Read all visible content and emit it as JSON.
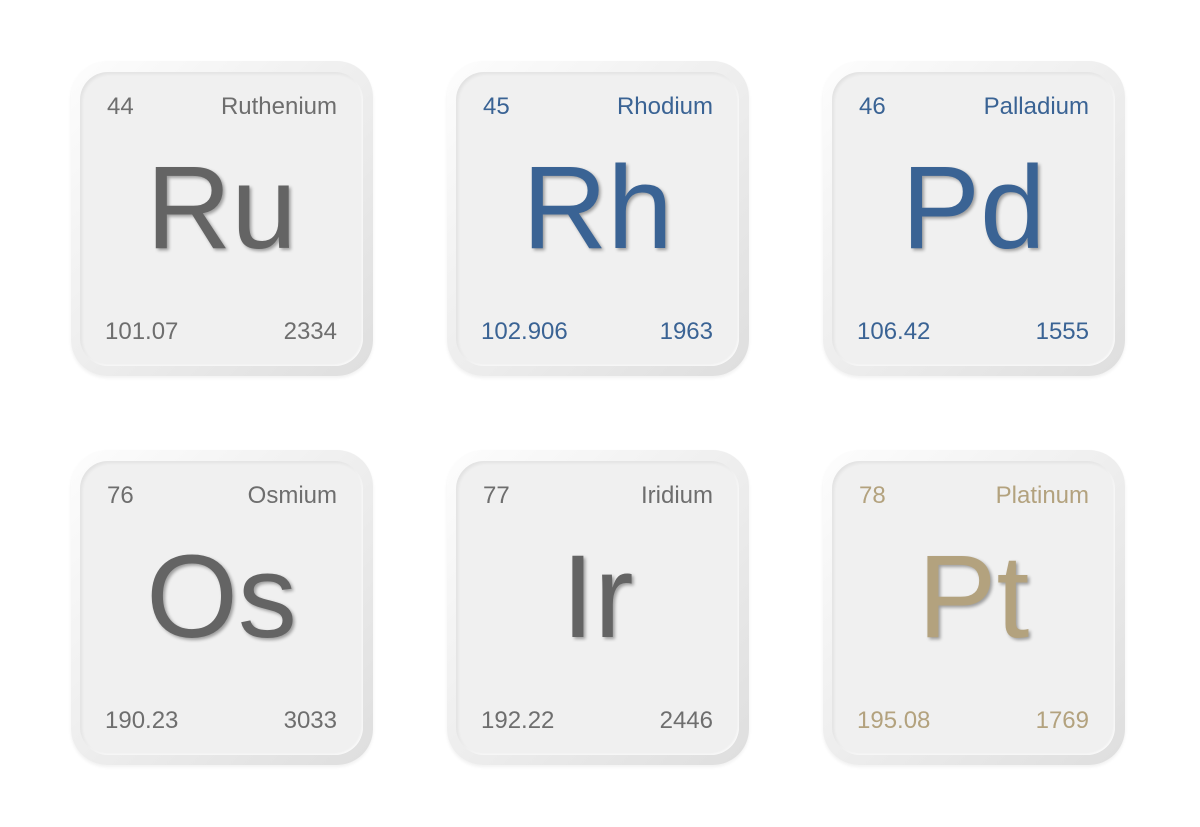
{
  "elements": [
    {
      "number": "44",
      "name": "Ruthenium",
      "symbol": "Ru",
      "mass": "101.07",
      "melting_point": "2334",
      "color_theme": "gray"
    },
    {
      "number": "45",
      "name": "Rhodium",
      "symbol": "Rh",
      "mass": "102.906",
      "melting_point": "1963",
      "color_theme": "blue"
    },
    {
      "number": "46",
      "name": "Palladium",
      "symbol": "Pd",
      "mass": "106.42",
      "melting_point": "1555",
      "color_theme": "blue"
    },
    {
      "number": "76",
      "name": "Osmium",
      "symbol": "Os",
      "mass": "190.23",
      "melting_point": "3033",
      "color_theme": "gray"
    },
    {
      "number": "77",
      "name": "Iridium",
      "symbol": "Ir",
      "mass": "192.22",
      "melting_point": "2446",
      "color_theme": "gray"
    },
    {
      "number": "78",
      "name": "Platinum",
      "symbol": "Pt",
      "mass": "195.08",
      "melting_point": "1769",
      "color_theme": "gold"
    }
  ],
  "colors": {
    "gray": "#646464",
    "blue": "#3a6394",
    "gold": "#b3a27e",
    "tile": "#f0f0f0"
  }
}
